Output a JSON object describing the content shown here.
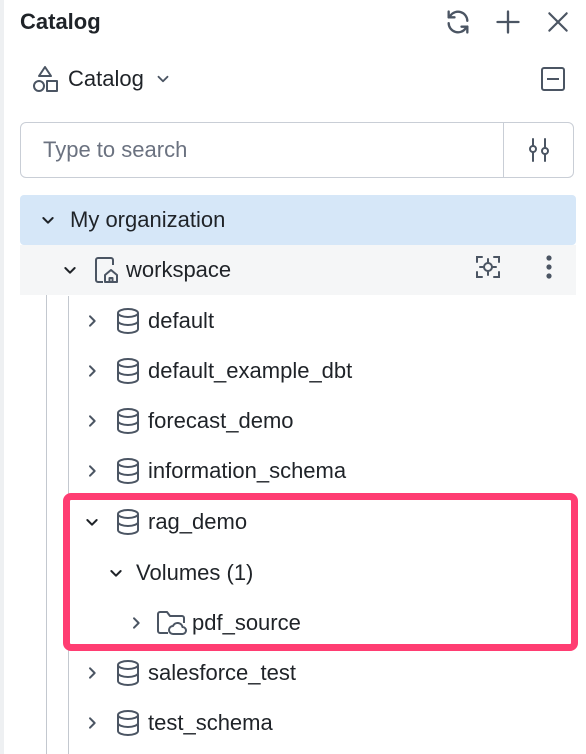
{
  "header": {
    "title": "Catalog",
    "icons": [
      "refresh-icon",
      "plus-icon",
      "close-icon"
    ]
  },
  "selector": {
    "label": "Catalog",
    "icon": "shapes-icon"
  },
  "search": {
    "placeholder": "Type to search",
    "value": ""
  },
  "tree": {
    "organization": "My organization",
    "workspace": "workspace",
    "schemas": {
      "default": "default",
      "default_example_dbt": "default_example_dbt",
      "forecast_demo": "forecast_demo",
      "information_schema": "information_schema",
      "rag_demo": "rag_demo",
      "volumes": "Volumes (1)",
      "pdf_source": "pdf_source",
      "salesforce_test": "salesforce_test",
      "test_schema": "test_schema"
    }
  },
  "colors": {
    "selected_row": "#d6e7f8",
    "highlight_border": "#ff3d72",
    "workspace_row": "#f5f6f7"
  }
}
